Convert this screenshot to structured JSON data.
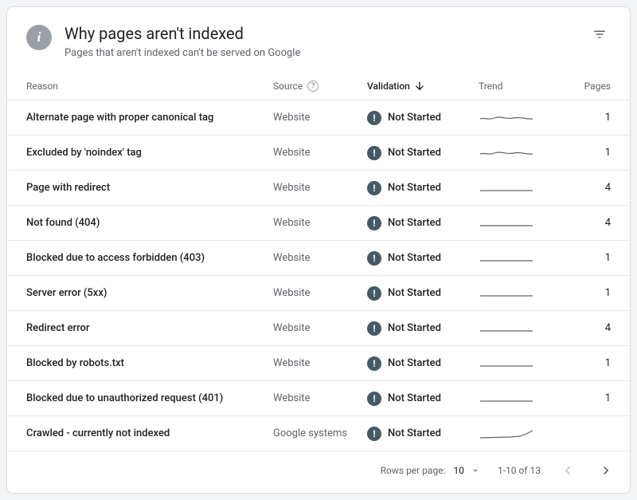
{
  "header": {
    "title": "Why pages aren't indexed",
    "subtitle": "Pages that aren't indexed can't be served on Google"
  },
  "columns": {
    "reason": "Reason",
    "source": "Source",
    "validation": "Validation",
    "trend": "Trend",
    "pages": "Pages"
  },
  "validation_label_not_started": "Not Started",
  "rows": [
    {
      "reason": "Alternate page with proper canonical tag",
      "source": "Website",
      "validation": "not_started",
      "trend": "wavy",
      "pages": "1"
    },
    {
      "reason": "Excluded by 'noindex' tag",
      "source": "Website",
      "validation": "not_started",
      "trend": "wavy",
      "pages": "1"
    },
    {
      "reason": "Page with redirect",
      "source": "Website",
      "validation": "not_started",
      "trend": "flat",
      "pages": "4"
    },
    {
      "reason": "Not found (404)",
      "source": "Website",
      "validation": "not_started",
      "trend": "flat",
      "pages": "4"
    },
    {
      "reason": "Blocked due to access forbidden (403)",
      "source": "Website",
      "validation": "not_started",
      "trend": "flat",
      "pages": "1"
    },
    {
      "reason": "Server error (5xx)",
      "source": "Website",
      "validation": "not_started",
      "trend": "flat",
      "pages": "1"
    },
    {
      "reason": "Redirect error",
      "source": "Website",
      "validation": "not_started",
      "trend": "flat",
      "pages": "4"
    },
    {
      "reason": "Blocked by robots.txt",
      "source": "Website",
      "validation": "not_started",
      "trend": "flat",
      "pages": "1"
    },
    {
      "reason": "Blocked due to unauthorized request (401)",
      "source": "Website",
      "validation": "not_started",
      "trend": "flat",
      "pages": "1"
    },
    {
      "reason": "Crawled - currently not indexed",
      "source": "Google systems",
      "validation": "not_started",
      "trend": "rise",
      "pages": ""
    }
  ],
  "footer": {
    "rows_per_page_label": "Rows per page:",
    "rows_per_page_value": "10",
    "range": "1-10 of 13"
  }
}
